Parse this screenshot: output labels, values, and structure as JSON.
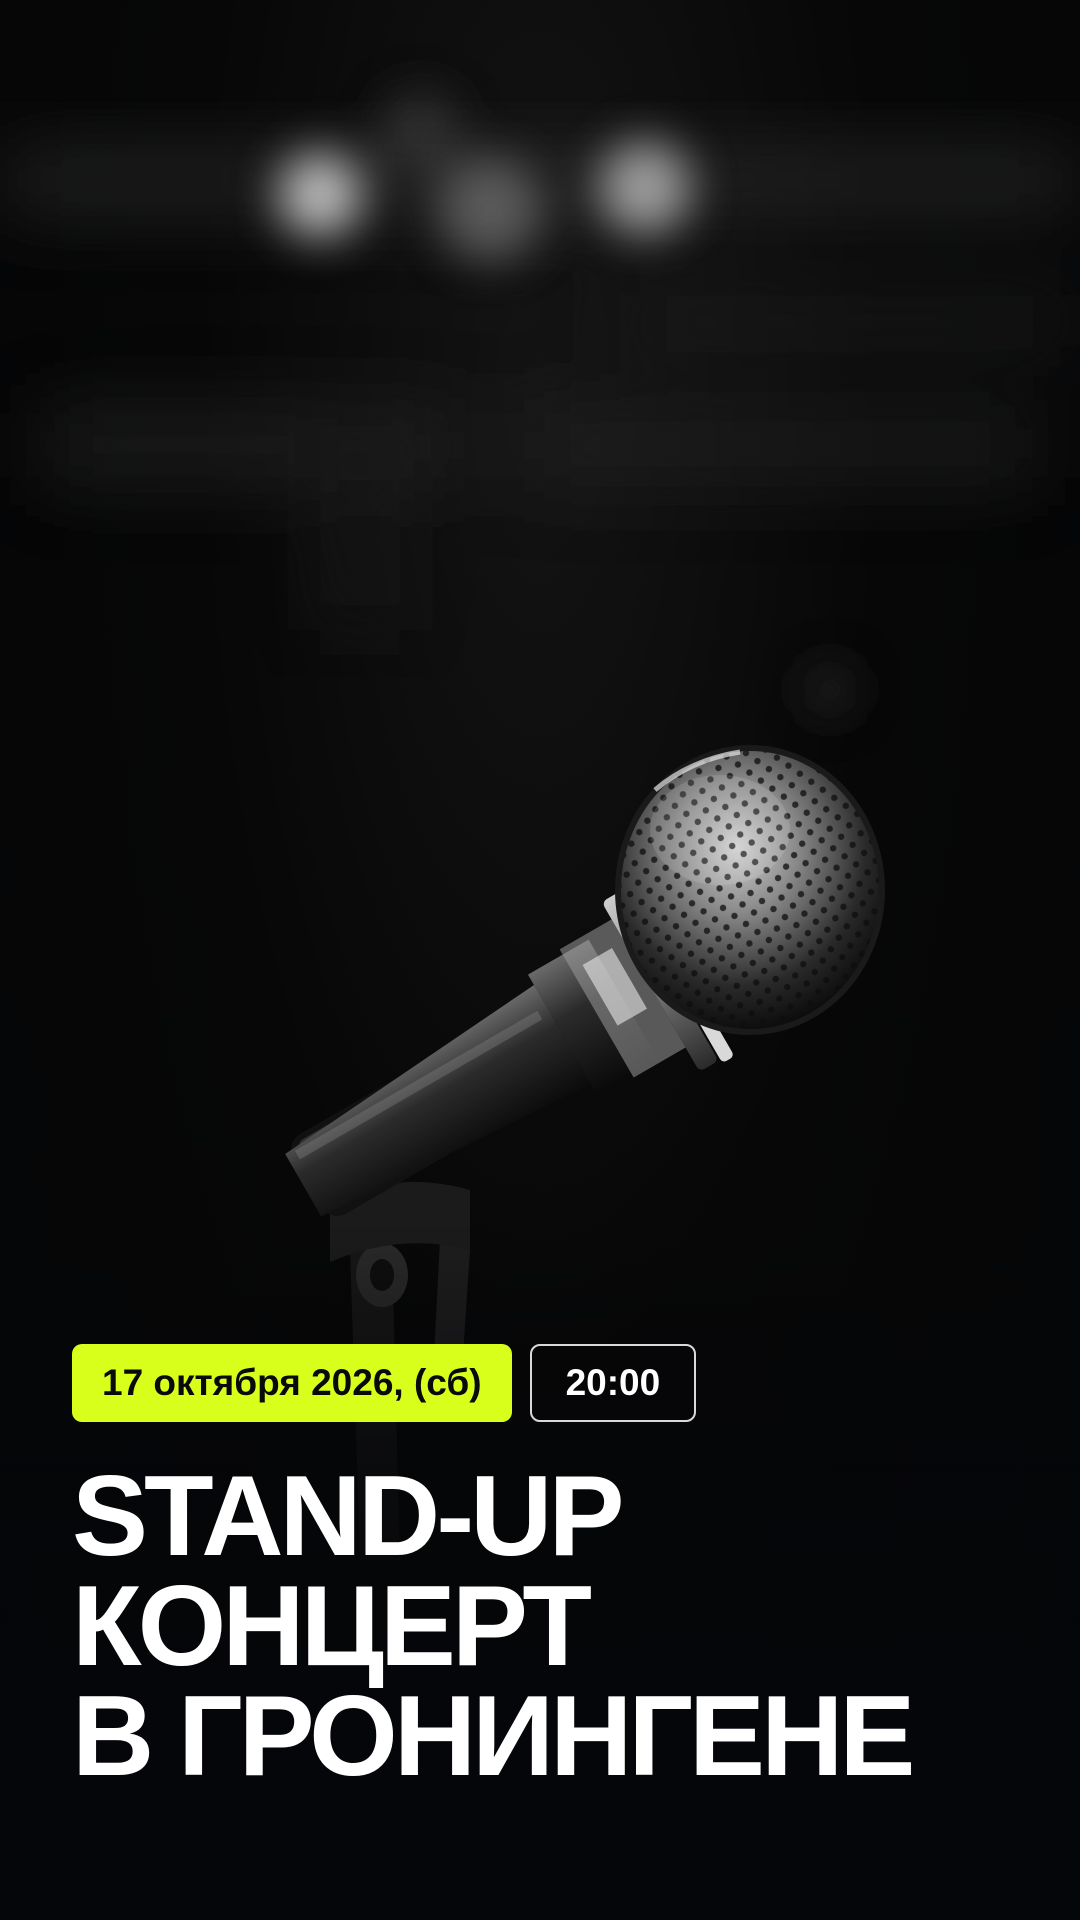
{
  "event": {
    "date_label": "17 октября 2026, (сб)",
    "time_label": "20:00",
    "title_lines": [
      "STAND-UP",
      "КОНЦЕРТ",
      "В ГРОНИНГЕНЕ"
    ]
  },
  "background": {
    "subject": "microphone-on-stand",
    "style": "black-and-white photo with bokeh lights"
  },
  "colors": {
    "accent": "#d8ff1c",
    "background": "#050608",
    "text": "#ffffff"
  }
}
